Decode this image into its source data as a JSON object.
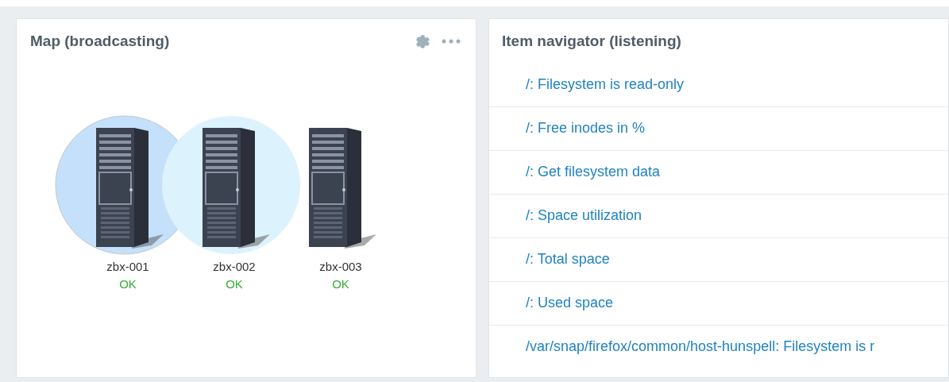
{
  "map_widget": {
    "title": "Map (broadcasting)",
    "hosts": [
      {
        "name": "zbx-001",
        "status": "OK",
        "selected": true,
        "hovered": false
      },
      {
        "name": "zbx-002",
        "status": "OK",
        "selected": false,
        "hovered": true
      },
      {
        "name": "zbx-003",
        "status": "OK",
        "selected": false,
        "hovered": false
      }
    ]
  },
  "item_navigator": {
    "title": "Item navigator (listening)",
    "items": [
      "/: Filesystem is read-only",
      "/: Free inodes in %",
      "/: Get filesystem data",
      "/: Space utilization",
      "/: Total space",
      "/: Used space",
      "/var/snap/firefox/common/host-hunspell: Filesystem is r"
    ]
  }
}
